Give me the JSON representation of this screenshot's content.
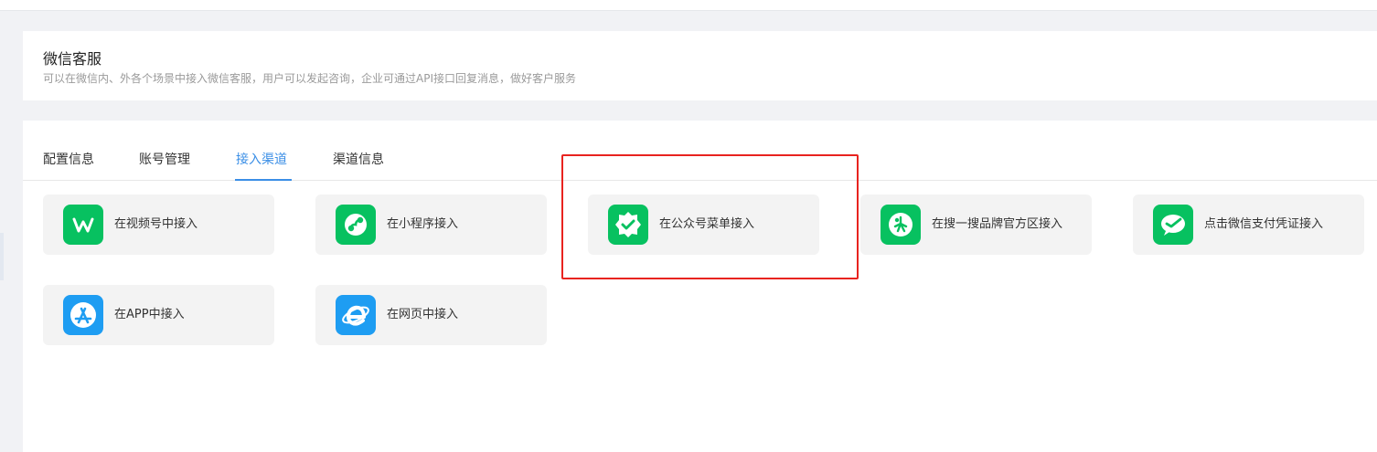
{
  "header": {
    "title": "微信客服",
    "description": "可以在微信内、外各个场景中接入微信客服，用户可以发起咨询，企业可通过API接口回复消息，做好客户服务"
  },
  "tabs": [
    {
      "label": "配置信息",
      "active": false
    },
    {
      "label": "账号管理",
      "active": false
    },
    {
      "label": "接入渠道",
      "active": true
    },
    {
      "label": "渠道信息",
      "active": false
    }
  ],
  "channels": [
    {
      "label": "在视频号中接入",
      "icon": "channels-icon",
      "color": "#07c160"
    },
    {
      "label": "在小程序接入",
      "icon": "mini-program-icon",
      "color": "#07c160"
    },
    {
      "label": "在公众号菜单接入",
      "icon": "official-account-icon",
      "color": "#07c160"
    },
    {
      "label": "在搜一搜品牌官方区接入",
      "icon": "search-brand-icon",
      "color": "#07c160"
    },
    {
      "label": "点击微信支付凭证接入",
      "icon": "wechat-pay-icon",
      "color": "#07c160"
    },
    {
      "label": "在APP中接入",
      "icon": "app-store-icon",
      "color": "#1e9df2"
    },
    {
      "label": "在网页中接入",
      "icon": "web-browser-icon",
      "color": "#1e9df2"
    }
  ],
  "colors": {
    "accent": "#3a8ee6",
    "highlight_border": "#e8231f",
    "wechat_green": "#07c160",
    "blue": "#1e9df2"
  }
}
